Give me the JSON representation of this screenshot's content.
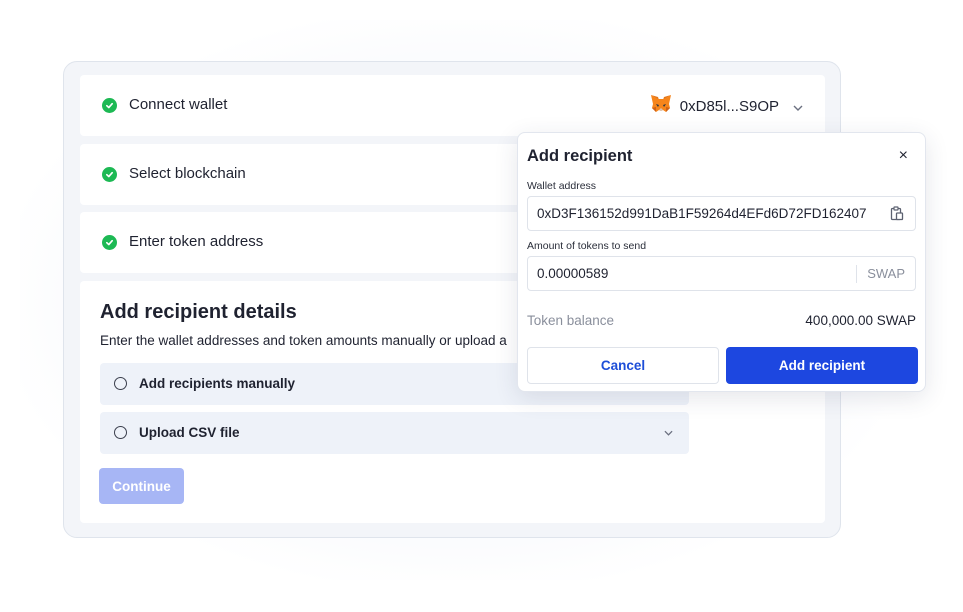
{
  "steps": [
    {
      "label": "Connect wallet"
    },
    {
      "label": "Select blockchain"
    },
    {
      "label": "Enter token address"
    }
  ],
  "wallet": {
    "address": "0xD85l...S9OP",
    "icon": "metamask-fox-icon"
  },
  "details": {
    "title": "Add recipient details",
    "description": "Enter the wallet addresses and token amounts manually or upload a",
    "options": [
      {
        "label": "Add recipients manually"
      },
      {
        "label": "Upload CSV file"
      }
    ],
    "continue_label": "Continue"
  },
  "modal": {
    "title": "Add recipient",
    "close_label": "×",
    "wallet_label": "Wallet address",
    "wallet_value": "0xD3F136152d991DaB1F59264d4EFd6D72FD162407",
    "amount_label": "Amount of tokens to send",
    "amount_value": "0.00000589",
    "amount_suffix": "SWAP",
    "balance_label": "Token balance",
    "balance_value": "400,000.00 SWAP",
    "cancel_label": "Cancel",
    "add_label": "Add recipient"
  },
  "colors": {
    "accent": "#1d47e0",
    "success": "#1db954",
    "disabled_button": "#a7b6f5"
  }
}
